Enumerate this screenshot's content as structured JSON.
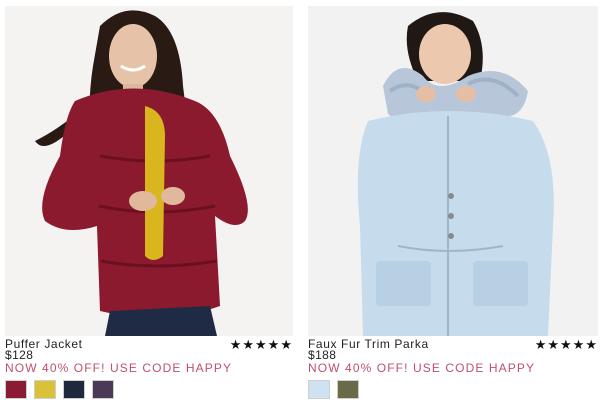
{
  "products": [
    {
      "name": "Puffer Jacket",
      "price": "$128",
      "promo": "NOW 40% OFF! USE CODE HAPPY",
      "rating": 5,
      "stars": "★★★★★",
      "swatches": [
        "#8b1a33",
        "#d9c13a",
        "#1e2a3b",
        "#4a3a55"
      ]
    },
    {
      "name": "Faux Fur Trim Parka",
      "price": "$188",
      "promo": "NOW 40% OFF! USE CODE HAPPY",
      "rating": 5,
      "stars": "★★★★★",
      "swatches": [
        "#cfe2f3",
        "#6b6a48"
      ]
    }
  ]
}
